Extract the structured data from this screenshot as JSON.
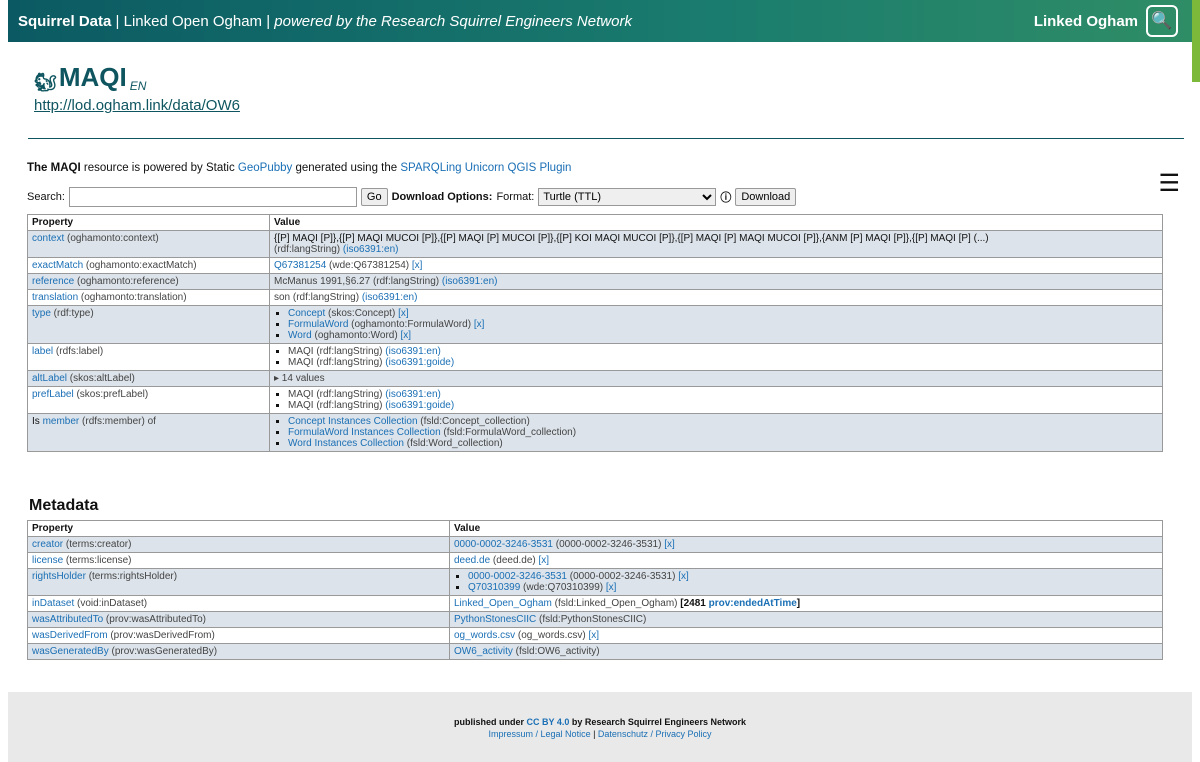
{
  "topbar": {
    "brand": "Squirrel Data",
    "sep1": " | ",
    "site": "Linked Open Ogham",
    "sep2": " | ",
    "tagline": "powered by the Research Squirrel Engineers Network",
    "right_label": "Linked Ogham"
  },
  "header": {
    "title": "MAQI",
    "lang": "EN",
    "uri": "http://lod.ogham.link/data/OW6"
  },
  "powered": {
    "prefix_bold": "The MAQI",
    "text1": " resource is powered by Static ",
    "link1": "GeoPubby",
    "text2": " generated using the ",
    "link2": "SPARQLing Unicorn QGIS Plugin"
  },
  "search": {
    "label": "Search:",
    "value": "",
    "go_label": "Go",
    "download_options": "Download Options:",
    "format_label": "Format:",
    "format_selected": "Turtle (TTL)",
    "info_glyph": "ⓘ",
    "download_label": "Download"
  },
  "colors": {
    "topbar": "#0b5a63",
    "accent": "#7cb83a",
    "link": "#1a6fb5",
    "row_alt": "#dce3ea"
  },
  "main_table": {
    "headers": [
      "Property",
      "Value"
    ],
    "rows": [
      {
        "prop": "context",
        "prop_note": " (oghamonto:context)",
        "value": "{[P] MAQI [P]},{[P] MAQI MUCOI [P]},{[P] MAQI [P] MUCOI [P]},{[P] KOI MAQI MUCOI [P]},{[P] MAQI [P] MAQI MUCOI [P]},{ANM [P] MAQI [P]},{[P] MAQI [P] (...)",
        "note": "(rdf:langString) ",
        "note_link": "(iso6391:en)"
      },
      {
        "prop": "exactMatch",
        "prop_note": " (oghamonto:exactMatch)",
        "link": "Q67381254",
        "plain": " (wde:Q67381254) ",
        "x": "[x]"
      },
      {
        "prop": "reference",
        "prop_note": " (oghamonto:reference)",
        "plain": "McManus 1991,§6.27 (rdf:langString) ",
        "link2": "(iso6391:en)"
      },
      {
        "prop": "translation",
        "prop_note": " (oghamonto:translation)",
        "plain": "son (rdf:langString) ",
        "link2": "(iso6391:en)"
      },
      {
        "prop": "type",
        "prop_note": " (rdf:type)",
        "items": [
          {
            "link": "Concept",
            "plain": " (skos:Concept) ",
            "x": "[x]"
          },
          {
            "link": "FormulaWord",
            "plain": " (oghamonto:FormulaWord) ",
            "x": "[x]"
          },
          {
            "link": "Word",
            "plain": " (oghamonto:Word) ",
            "x": "[x]"
          }
        ]
      },
      {
        "prop": "label",
        "prop_note": " (rdfs:label)",
        "items": [
          {
            "plain": "MAQI (rdf:langString) ",
            "link2": "(iso6391:en)"
          },
          {
            "plain": "MAQI (rdf:langString) ",
            "link2": "(iso6391:goide)"
          }
        ]
      },
      {
        "prop": "altLabel",
        "prop_note": " (skos:altLabel)",
        "plain": "▸ 14 values"
      },
      {
        "prop": "prefLabel",
        "prop_note": " (skos:prefLabel)",
        "items": [
          {
            "plain": "MAQI (rdf:langString) ",
            "link2": "(iso6391:en)"
          },
          {
            "plain": "MAQI (rdf:langString) ",
            "link2": "(iso6391:goide)"
          }
        ]
      },
      {
        "prop_prefix": "Is ",
        "prop": "member",
        "prop_note": " (rdfs:member) of",
        "items": [
          {
            "link": "Concept Instances Collection",
            "plain": " (fsld:Concept_collection)"
          },
          {
            "link": "FormulaWord Instances Collection",
            "plain": " (fsld:FormulaWord_collection)"
          },
          {
            "link": "Word Instances Collection",
            "plain": " (fsld:Word_collection)"
          }
        ]
      }
    ]
  },
  "metadata": {
    "heading": "Metadata",
    "headers": [
      "Property",
      "Value"
    ],
    "rows": [
      {
        "prop": "creator",
        "prop_note": " (terms:creator)",
        "link": "0000-0002-3246-3531",
        "plain": " (0000-0002-3246-3531) ",
        "x": "[x]"
      },
      {
        "prop": "license",
        "prop_note": " (terms:license)",
        "link": "deed.de",
        "plain": " (deed.de) ",
        "x": "[x]"
      },
      {
        "prop": "rightsHolder",
        "prop_note": " (terms:rightsHolder)",
        "items": [
          {
            "link": "0000-0002-3246-3531",
            "plain": " (0000-0002-3246-3531) ",
            "x": "[x]"
          },
          {
            "link": "Q70310399",
            "plain": " (wde:Q70310399) ",
            "x": "[x]"
          }
        ]
      },
      {
        "prop": "inDataset",
        "prop_note": " (void:inDataset)",
        "link": "Linked_Open_Ogham",
        "plain": " (fsld:Linked_Open_Ogham) ",
        "bold1": "[2481 ",
        "bold_link": "prov:endedAtTime",
        "bold2": "]"
      },
      {
        "prop": "wasAttributedTo",
        "prop_note": " (prov:wasAttributedTo)",
        "link": "PythonStonesCIIC",
        "plain": " (fsld:PythonStonesCIIC)"
      },
      {
        "prop": "wasDerivedFrom",
        "prop_note": " (prov:wasDerivedFrom)",
        "link": "og_words.csv",
        "plain": " (og_words.csv) ",
        "x": "[x]"
      },
      {
        "prop": "wasGeneratedBy",
        "prop_note": " (prov:wasGeneratedBy)",
        "link": "OW6_activity",
        "plain": " (fsld:OW6_activity)"
      }
    ]
  },
  "footer": {
    "line1_a": "published under ",
    "line1_link": "CC BY 4.0",
    "line1_b": " by Research Squirrel Engineers Network",
    "impressum": "Impressum / Legal Notice",
    "sep": " | ",
    "privacy": "Datenschutz / Privacy Policy"
  }
}
